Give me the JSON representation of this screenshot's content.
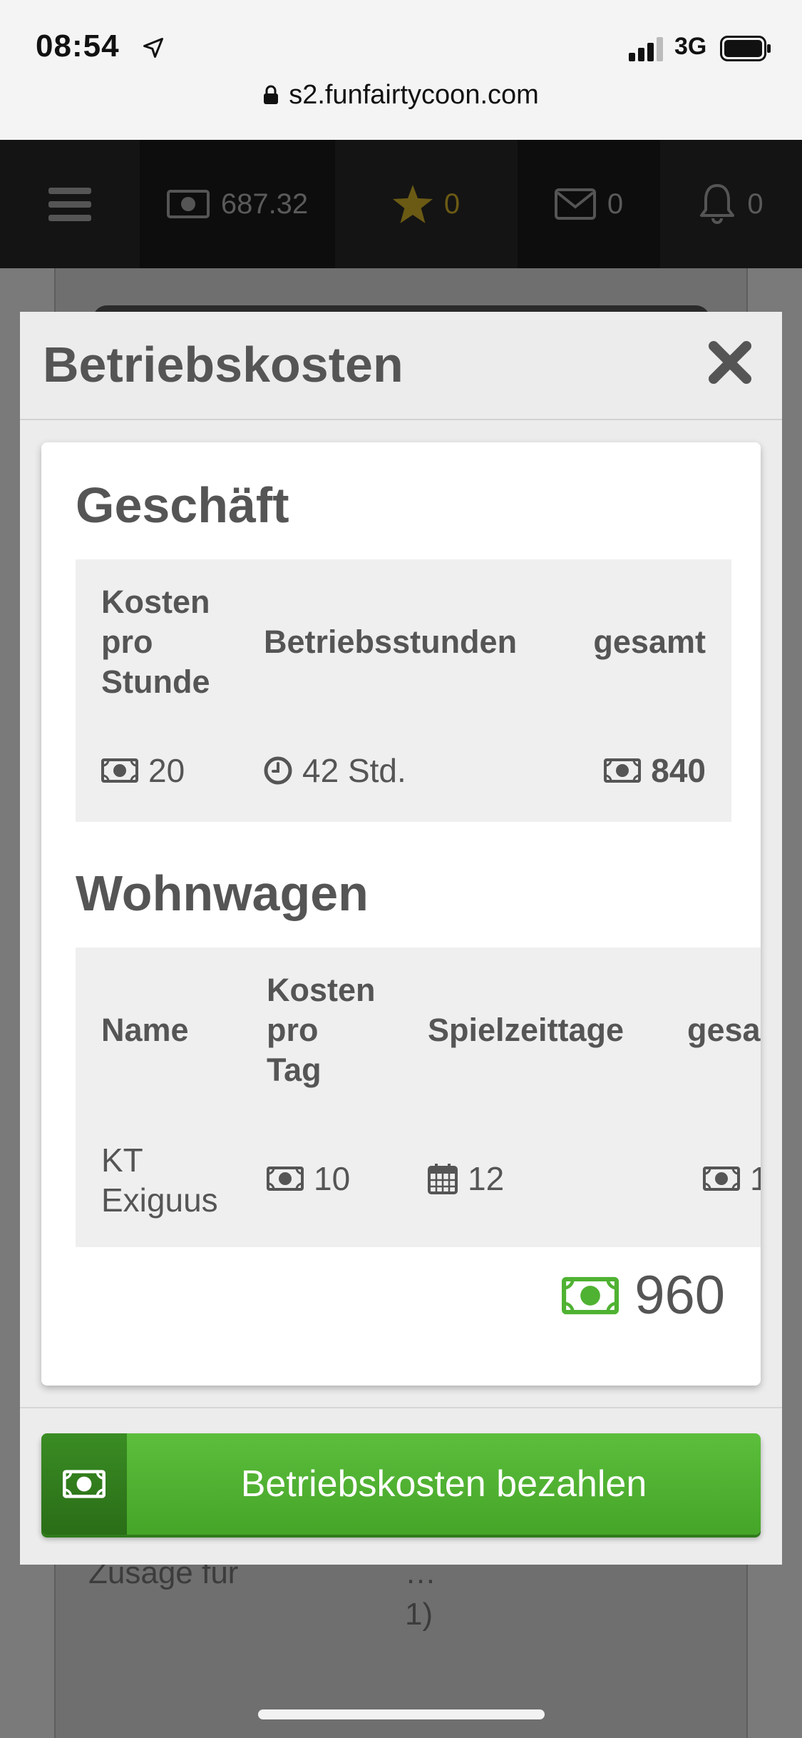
{
  "status_bar": {
    "time": "08:54",
    "network": "3G"
  },
  "browser": {
    "url": "s2.funfairtycoon.com"
  },
  "game_bar": {
    "money": "687.32",
    "stars": "0",
    "messages": "0",
    "notifications": "0"
  },
  "background": {
    "left_text": "Zusage für",
    "right_text_line1": "…",
    "right_text_line2": "1)"
  },
  "modal": {
    "title": "Betriebskosten",
    "business": {
      "title": "Geschäft",
      "headers": {
        "cost_per_hour_l1": "Kosten",
        "cost_per_hour_l2": "pro",
        "cost_per_hour_l3": "Stunde",
        "hours": "Betriebsstunden",
        "total": "gesamt"
      },
      "row": {
        "cost_per_hour": "20",
        "hours": "42 Std.",
        "total": "840"
      }
    },
    "caravans": {
      "title": "Wohnwagen",
      "headers": {
        "name": "Name",
        "cost_per_day_l1": "Kosten",
        "cost_per_day_l2": "pro",
        "cost_per_day_l3": "Tag",
        "game_days": "Spielzeittage",
        "total": "gesa"
      },
      "row": {
        "name_l1": "KT",
        "name_l2": "Exiguus",
        "cost_per_day": "10",
        "game_days": "12",
        "total": "1"
      }
    },
    "grand_total": "960",
    "pay_button_label": "Betriebskosten bezahlen"
  },
  "colors": {
    "accent_green": "#4fb232",
    "money_icon": "#555555"
  }
}
